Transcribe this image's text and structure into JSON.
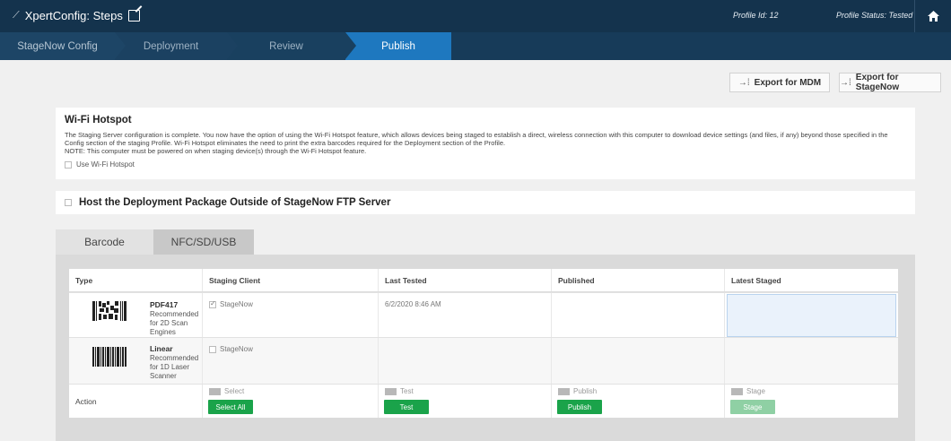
{
  "app": {
    "title": "XpertConfig: Steps",
    "profile_id": "Profile Id: 12",
    "profile_status": "Profile Status: Tested"
  },
  "steps": [
    {
      "label": "StageNow Config"
    },
    {
      "label": "Deployment"
    },
    {
      "label": "Review"
    },
    {
      "label": "Publish"
    }
  ],
  "export": {
    "mdm_label": "Export for MDM",
    "stagenow_label": "Export for StageNow"
  },
  "wifi": {
    "title": "Wi-Fi Hotspot",
    "desc1": "The Staging Server configuration is complete. You now have the option of using the Wi-Fi Hotspot feature, which allows devices being staged to establish a direct, wireless connection with this computer to download device settings (and files, if any) beyond those specified in the Config section of the staging Profile. Wi-Fi Hotspot eliminates the need to print the extra barcodes required for the Deployment section of the Profile.",
    "desc2": "NOTE: This computer must be powered on when staging device(s) through the Wi-Fi Hotspot feature.",
    "checkbox_label": "Use Wi-Fi Hotspot"
  },
  "host": {
    "label": "Host the Deployment Package Outside of StageNow FTP Server"
  },
  "tabs": {
    "barcode": "Barcode",
    "nfc": "NFC/SD/USB"
  },
  "table": {
    "headers": [
      "Type",
      "Staging Client",
      "Last Tested",
      "Published",
      "Latest Staged"
    ],
    "rows": [
      {
        "type": "PDF417",
        "desc": "Recommended for 2D Scan Engines",
        "client": "StageNow",
        "client_checked": true,
        "last_tested": "6/2/2020 8:46 AM"
      },
      {
        "type": "Linear",
        "desc": "Recommended for 1D Laser Scanner",
        "client": "StageNow",
        "client_checked": false,
        "last_tested": ""
      }
    ],
    "action": {
      "label": "Action",
      "select_label": "Select",
      "select_button": "Select All",
      "test_label": "Test",
      "test_button": "Test",
      "publish_label": "Publish",
      "publish_button": "Publish",
      "stage_label": "Stage",
      "stage_button": "Stage"
    }
  },
  "colors": {
    "topbar": "#14334d",
    "active_step": "#1e78bf",
    "action_green": "#1aa34a"
  }
}
